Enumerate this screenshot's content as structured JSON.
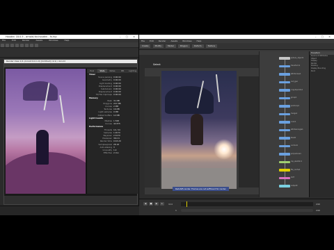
{
  "left_app": {
    "title": "Houdini 18.0.5 - arnold-for-houdini - fx.hip",
    "menu": [
      "File",
      "Edit",
      "Render",
      "Assets",
      "Windows",
      "Help"
    ],
    "render_window_title": "Render View 1/1 (Arnold 6.0.1.0) [Untitled] (1/1) / Arnold",
    "tabs": [
      "Pool",
      "Stats",
      "Notes",
      "IPR",
      "Lighting"
    ],
    "active_tab": "Stats",
    "stats": [
      {
        "k": "Timer",
        "v": "",
        "hdr": true
      },
      {
        "k": "Scene parsing",
        "v": "0:00:00"
      },
      {
        "k": "Geometry",
        "v": "0:00:00"
      },
      {
        "k": "Light loading",
        "v": "0:00:00"
      },
      {
        "k": "Displacement",
        "v": "0:00:00"
      },
      {
        "k": "Subdivision",
        "v": "0:00:00"
      },
      {
        "k": "Displacement",
        "v": "0:00:00"
      },
      {
        "k": "TX/Tile mipmaps",
        "v": "0:00:00"
      },
      {
        "k": "Memory",
        "v": "",
        "hdr": true
      },
      {
        "k": "Peak",
        "v": "31 MB"
      },
      {
        "k": "Polygons",
        "v": "221 MB"
      },
      {
        "k": "Curves",
        "v": "2 MB"
      },
      {
        "k": "Textures",
        "v": "16 MB"
      },
      {
        "k": "Light samples",
        "v": "0 MB"
      },
      {
        "k": "Output buffers",
        "v": "12 MB"
      },
      {
        "k": "Light Counts",
        "v": "",
        "hdr": true
      },
      {
        "k": "Meshes",
        "v": "1 568"
      },
      {
        "k": "Curves",
        "v": "40 875"
      },
      {
        "k": "Performance",
        "v": "",
        "hdr": true
      },
      {
        "k": "Threads",
        "v": "10 / 24"
      },
      {
        "k": "Samples",
        "v": "1.00 M"
      },
      {
        "k": "Rays/sec",
        "v": "2.34 M"
      },
      {
        "k": "Pixels/sec",
        "v": "38.0 K"
      },
      {
        "k": "Render time",
        "v": "0:43.20"
      },
      {
        "k": "Samples/pixel",
        "v": "28.18"
      },
      {
        "k": "Anti-aliasing",
        "v": "3"
      },
      {
        "k": "GI quality",
        "v": "1.0"
      },
      {
        "k": "Effective",
        "v": "2 min"
      }
    ]
  },
  "right_app": {
    "menu": [
      "File",
      "Edit",
      "Render",
      "Assets",
      "Windows",
      "Help"
    ],
    "shelf_tabs": [
      "Create",
      "Modify",
      "Model",
      "Polygon",
      "Deform",
      "Texture"
    ],
    "viewport_label": "Select",
    "caption": "Redshift-render. Frames are not sufficient for render",
    "nodes": [
      {
        "label": "sphere_object1",
        "color": "#c7c7c7"
      },
      {
        "label": "transform1",
        "color": "#6aa0e0"
      },
      {
        "label": "attribnoise1",
        "color": "#6aa0e0"
      },
      {
        "label": "null_geo",
        "color": "#6aa0e0"
      },
      {
        "label": "copytopoints1",
        "color": "#6aa0e0"
      },
      {
        "label": "group1",
        "color": "#6aa0e0"
      },
      {
        "label": "pointvop1",
        "color": "#6aa0e0"
      },
      {
        "label": "merge1",
        "color": "#6aa0e0"
      },
      {
        "label": "color1",
        "color": "#6aa0e0"
      },
      {
        "label": "attribwrangle1",
        "color": "#6aa0e0"
      },
      {
        "label": "blast1",
        "color": "#6aa0e0"
      },
      {
        "label": "normal1",
        "color": "#6aa0e0"
      },
      {
        "label": "polyreduce1",
        "color": "#6aa0e0"
      },
      {
        "label": "rop_alembic1",
        "color": "#a0d070"
      },
      {
        "label": "file_cache1",
        "color": "#e0d000"
      },
      {
        "label": "OUT",
        "color": "#d870c0"
      },
      {
        "label": "output0",
        "color": "#7ad0e0"
      }
    ],
    "params_tab": "Transform",
    "params": [
      "Source of Attributes",
      "Object",
      "Display",
      "Render",
      "Shading",
      "Display Bounding",
      "Pivot"
    ],
    "frame_start": "1",
    "frame_current": "114",
    "frame_end": "240",
    "frame_end2": "240"
  }
}
